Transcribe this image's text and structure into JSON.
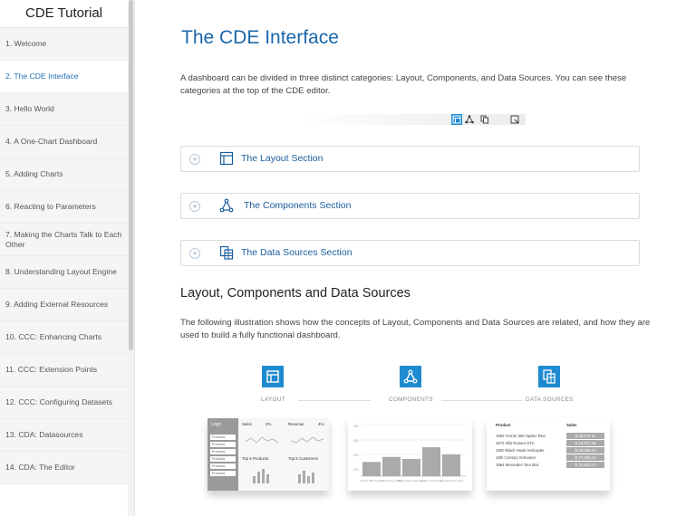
{
  "sidebar": {
    "title": "CDE Tutorial",
    "items": [
      {
        "label": "1. Welcome"
      },
      {
        "label": "2. The CDE Interface"
      },
      {
        "label": "3. Hello World"
      },
      {
        "label": "4. A One-Chart Dashboard"
      },
      {
        "label": "5. Adding Charts"
      },
      {
        "label": "6. Reacting to Parameters"
      },
      {
        "label": "7. Making the Charts Talk to Each Other"
      },
      {
        "label": "8. Understanding Layout Engine"
      },
      {
        "label": "9. Adding External Resources"
      },
      {
        "label": "10. CCC: Enhancing Charts"
      },
      {
        "label": "11. CCC: Extension Points"
      },
      {
        "label": "12. CCC: Configuring Datasets"
      },
      {
        "label": "13. CDA: Datasources"
      },
      {
        "label": "14. CDA: The Editor"
      }
    ]
  },
  "main": {
    "title": "The CDE Interface",
    "intro": "A dashboard can be divided in three distinct categories: Layout, Components, and Data Sources. You can see these categories at the top of the CDE editor.",
    "sections": [
      {
        "label": "The Layout Section",
        "icon": "layout-icon"
      },
      {
        "label": "The Components Section",
        "icon": "components-icon"
      },
      {
        "label": "The Data Sources Section",
        "icon": "datasources-icon"
      }
    ],
    "subtitle": "Layout, Components and Data Sources",
    "illustration_text": "The following illustration shows how the concepts of Layout, Components and Data Sources are related, and how they are used to build a fully functional dashboard.",
    "illustration": {
      "layout_label": "LAYOUT",
      "components_label": "COMPONENTS",
      "datasources_label": "DATA SOURCES",
      "layout_card": {
        "logo": "Logo",
        "products": [
          "Products",
          "Products",
          "Products",
          "Products",
          "Products",
          "Products"
        ],
        "sales": "Sales",
        "revenue": "Revenue",
        "sales_value": "2%",
        "revenue_value": "4%",
        "top_products": "Top 5 Products",
        "top_customers": "Top 5 Customers"
      },
      "chart_card": {
        "y_ticks": [
          "400",
          "300",
          "200",
          "100"
        ],
        "bar_values": [
          0.28,
          0.38,
          0.34,
          0.57,
          0.43
        ],
        "categories": [
          "Ferrari 360 Spyder",
          "Alfa Romeo GTA",
          "Black Hawk Helicopter",
          "Century Schooner",
          "Mercedes Tour Bus"
        ]
      },
      "table_card": {
        "headers": [
          "Product",
          "Sales"
        ],
        "rows": [
          {
            "product": "1992 Ferrari 360 Spider Red",
            "sales": "$ 36,274.11"
          },
          {
            "product": "1972 Alfa Romeo GTA",
            "sales": "$ 42,372.48"
          },
          {
            "product": "1900 Black Hawk Helicopter",
            "sales": "$ 28,008.10"
          },
          {
            "product": "18th Century Schooner",
            "sales": "$ 27,255.13"
          },
          {
            "product": "1964 Mercedes Tour Bus",
            "sales": "$ 31,612.41"
          }
        ]
      }
    }
  },
  "toolbar": {
    "buttons": [
      "layout-icon",
      "components-icon",
      "datasources-icon",
      "preview-icon"
    ],
    "selected": "layout-icon"
  },
  "colors": {
    "accent": "#1e8bd1",
    "title": "#1a67ac",
    "link": "#1a5d9c"
  }
}
